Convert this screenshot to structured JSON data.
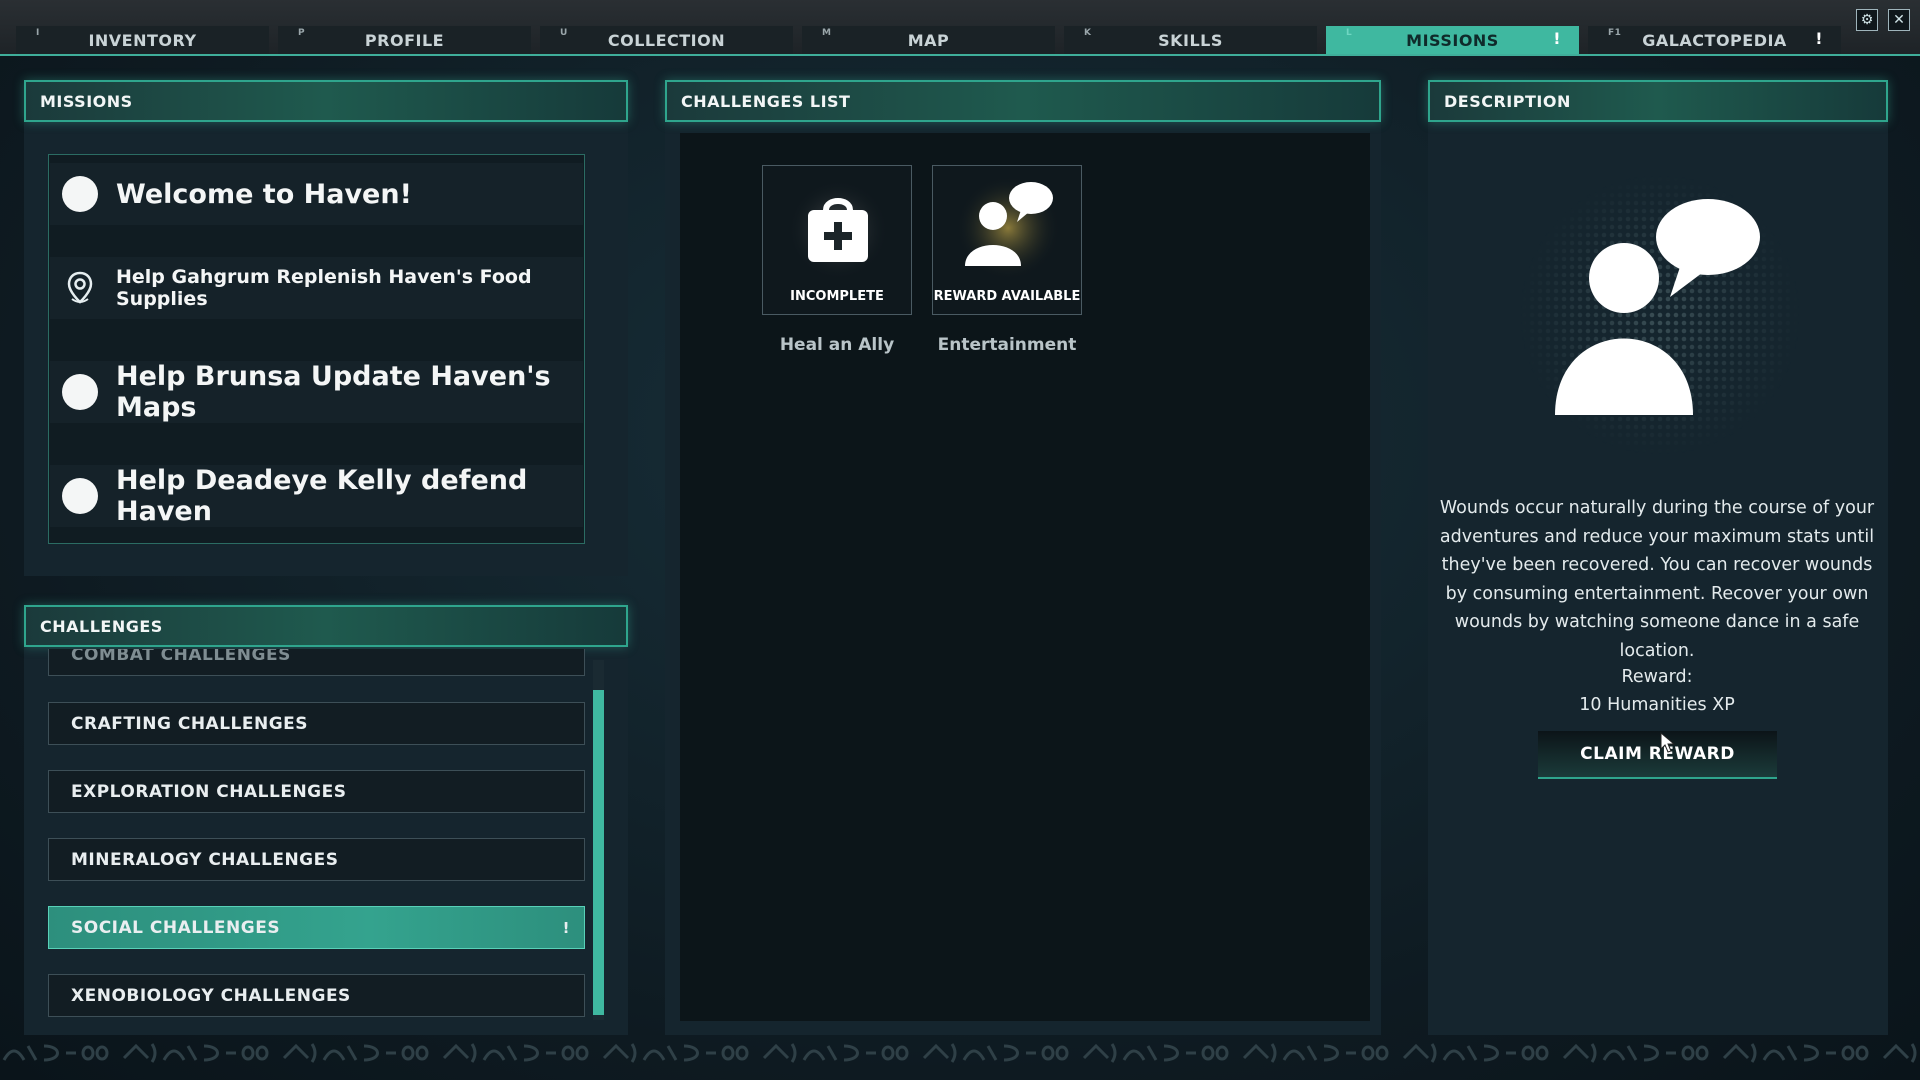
{
  "tabs": [
    {
      "key": "I",
      "label": "INVENTORY",
      "alert": ""
    },
    {
      "key": "P",
      "label": "PROFILE",
      "alert": ""
    },
    {
      "key": "U",
      "label": "COLLECTION",
      "alert": ""
    },
    {
      "key": "M",
      "label": "MAP",
      "alert": ""
    },
    {
      "key": "K",
      "label": "SKILLS",
      "alert": ""
    },
    {
      "key": "L",
      "label": "MISSIONS",
      "alert": "!"
    },
    {
      "key": "F1",
      "label": "GALACTOPEDIA",
      "alert": "!"
    }
  ],
  "active_tab": "MISSIONS",
  "window_controls": {
    "settings_glyph": "⚙",
    "close_glyph": "✕"
  },
  "missions_panel": {
    "title": "MISSIONS",
    "items": [
      {
        "label": "Welcome to Haven!",
        "icon": "circle-icon"
      },
      {
        "label": "Help Gahgrum Replenish Haven's Food Supplies",
        "icon": "map-pin-icon"
      },
      {
        "label": "Help Brunsa Update Haven's Maps",
        "icon": "circle-icon"
      },
      {
        "label": "Help Deadeye Kelly defend Haven",
        "icon": "circle-icon"
      }
    ]
  },
  "challenges_panel": {
    "title": "CHALLENGES",
    "items": [
      {
        "label": "COMBAT CHALLENGES",
        "alert": ""
      },
      {
        "label": "CRAFTING CHALLENGES",
        "alert": ""
      },
      {
        "label": "EXPLORATION CHALLENGES",
        "alert": ""
      },
      {
        "label": "MINERALOGY CHALLENGES",
        "alert": ""
      },
      {
        "label": "SOCIAL CHALLENGES",
        "alert": "!"
      },
      {
        "label": "XENOBIOLOGY CHALLENGES",
        "alert": ""
      }
    ],
    "selected": "SOCIAL CHALLENGES"
  },
  "challenges_list": {
    "title": "CHALLENGES LIST",
    "cards": [
      {
        "name": "Heal an Ally",
        "status": "INCOMPLETE",
        "icon": "medkit-icon"
      },
      {
        "name": "Entertainment",
        "status": "REWARD AVAILABLE",
        "icon": "person-speech-icon"
      }
    ]
  },
  "description": {
    "title": "DESCRIPTION",
    "icon": "person-speech-icon",
    "text": "Wounds occur naturally during the course of your adventures and reduce your maximum stats until they've been recovered. You can recover wounds by consuming entertainment. Recover your own wounds by watching someone dance in a safe location.",
    "reward_label": "Reward:",
    "reward_value": "10 Humanities XP",
    "claim_button": "CLAIM REWARD"
  },
  "colors": {
    "accent": "#3fb8a0",
    "panel": "#15252e",
    "background": "#0f1c24"
  }
}
